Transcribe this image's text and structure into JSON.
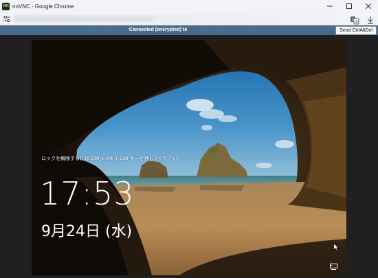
{
  "window": {
    "app_icon_text": "VNC",
    "title": "noVNC - Google Chrome",
    "controls": [
      "minimize",
      "maximize",
      "close"
    ]
  },
  "toolbar": {
    "icons": [
      "site-info-icon",
      "translate-icon",
      "download-icon"
    ]
  },
  "vnc": {
    "status": "Connected (encrypted) to",
    "send_cad_label": "Send CtrlAltDel"
  },
  "lockscreen": {
    "hint": "ロックを解除するには Ctrl + Alt + Del キーを押してください。",
    "time": "17:53",
    "date": "9月24日 (水)"
  },
  "colors": {
    "chrome_bg": "#f1f3f6",
    "status_bar": "#4a6b8d",
    "page_bg": "#202020"
  }
}
